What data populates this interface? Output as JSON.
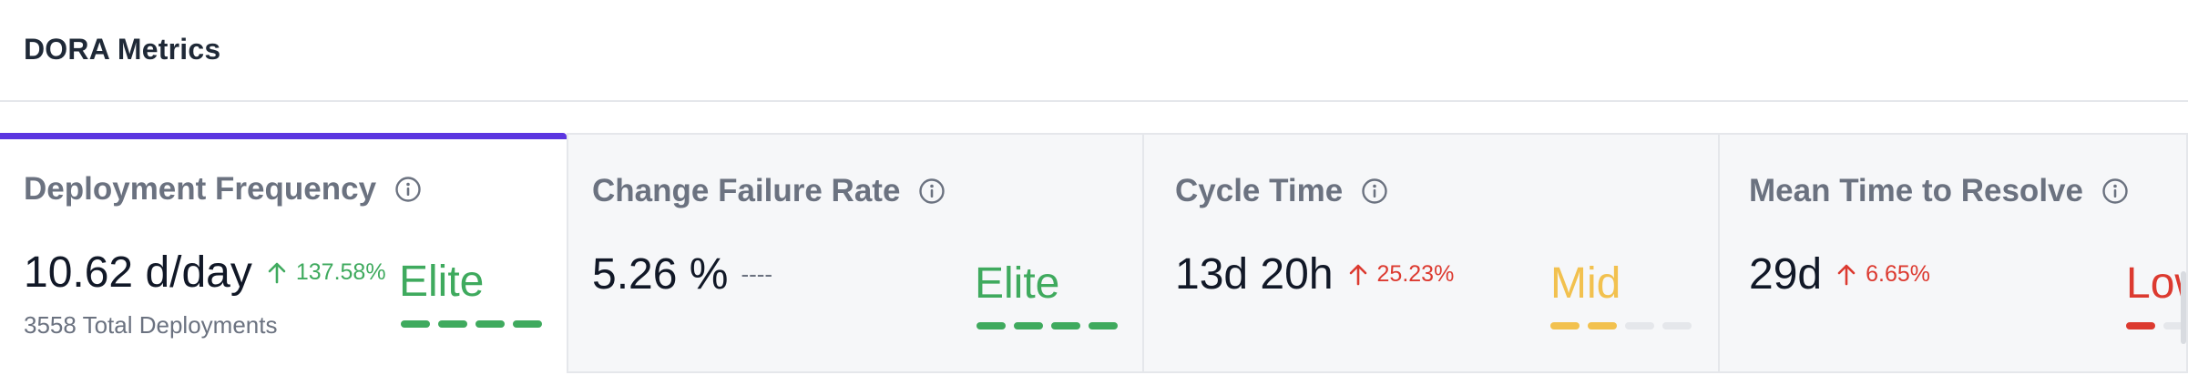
{
  "header": {
    "title": "DORA Metrics"
  },
  "colors": {
    "accent": "#5b36e0",
    "elite": "#3faa5e",
    "mid": "#f2c14f",
    "low": "#dc3a30",
    "bar_inactive": "#e5e7eb"
  },
  "cards": [
    {
      "title": "Deployment Frequency",
      "value": "10.62 d/day",
      "change": "137.58%",
      "change_direction": "up",
      "change_color": "green",
      "subtext": "3558 Total Deployments",
      "level": "Elite",
      "level_color": "#3faa5e",
      "bars_filled": 4,
      "bars_total": 4,
      "active": true
    },
    {
      "title": "Change Failure Rate",
      "value": "5.26 %",
      "change": "----",
      "change_direction": "none",
      "change_color": "none",
      "subtext": "",
      "level": "Elite",
      "level_color": "#3faa5e",
      "bars_filled": 4,
      "bars_total": 4,
      "active": false
    },
    {
      "title": "Cycle Time",
      "value": "13d 20h",
      "change": "25.23%",
      "change_direction": "up",
      "change_color": "red",
      "subtext": "",
      "level": "Mid",
      "level_color": "#f2c14f",
      "bars_filled": 2,
      "bars_total": 4,
      "active": false
    },
    {
      "title": "Mean Time to Resolve",
      "value": "29d",
      "change": "6.65%",
      "change_direction": "up",
      "change_color": "red",
      "subtext": "",
      "level": "Low",
      "level_color": "#dc3a30",
      "bars_filled": 1,
      "bars_total": 4,
      "active": false
    }
  ]
}
